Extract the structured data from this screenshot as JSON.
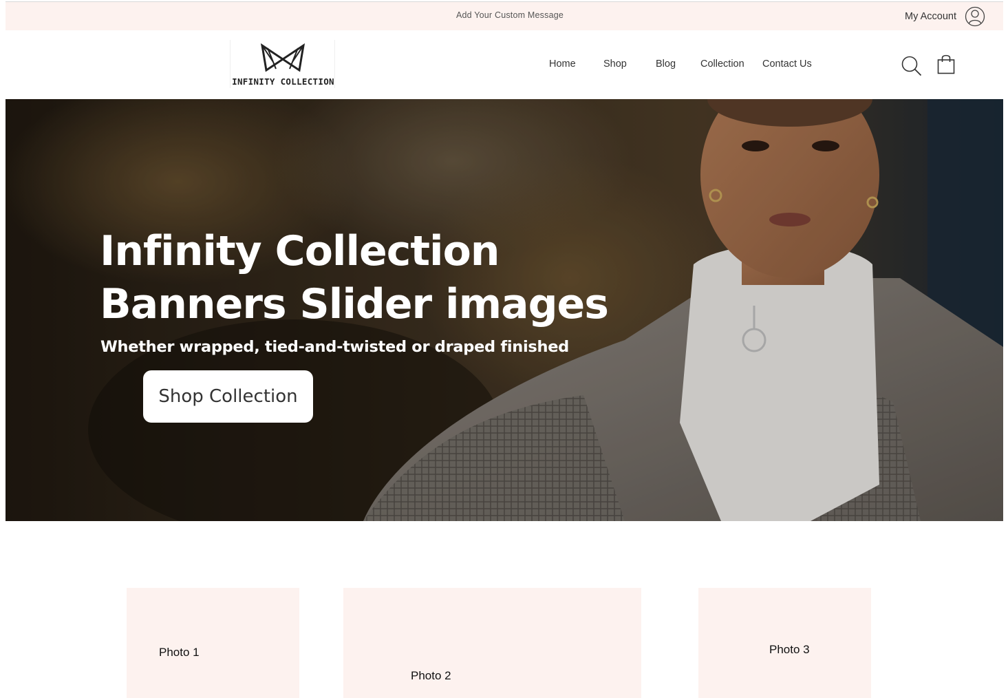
{
  "announcement": {
    "message": "Add Your Custom Message"
  },
  "account": {
    "label": "My Account",
    "icon": "user-icon"
  },
  "logo": {
    "text": "INFINITY COLLECTION",
    "icon": "bow-logo-icon"
  },
  "nav": {
    "items": [
      "Home",
      "Shop",
      "Blog",
      "Collection",
      "Contact Us"
    ]
  },
  "header_icons": {
    "search": "search-icon",
    "cart": "shopping-bag-icon"
  },
  "hero": {
    "title_line1": "Infinity Collection",
    "title_line2": "Banners Slider images",
    "subtitle": "Whether wrapped, tied-and-twisted or draped finished",
    "button_label": "Shop Collection"
  },
  "photos": [
    "Photo 1",
    "Photo 2",
    "Photo 3"
  ],
  "colors": {
    "accent_bg": "#fdf2ef",
    "text_dark": "#333333",
    "hero_text": "#ffffff"
  }
}
